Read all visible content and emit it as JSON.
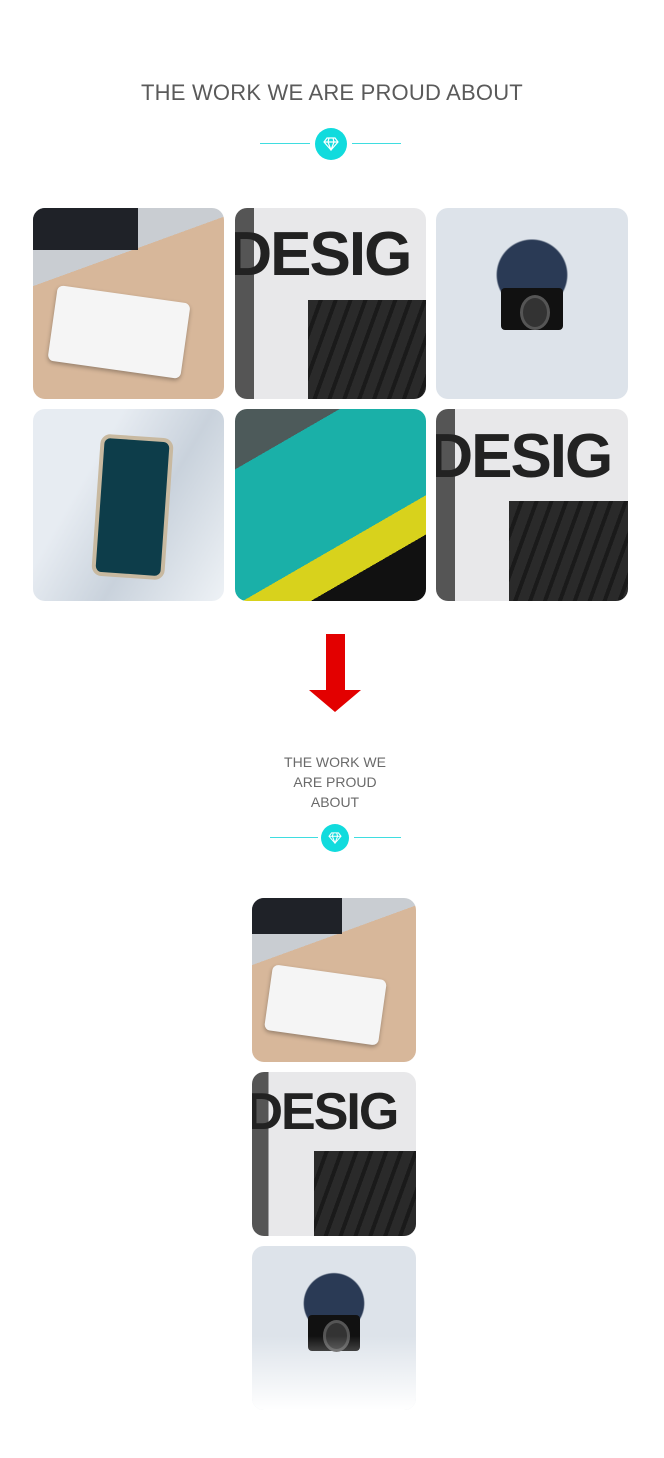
{
  "desktop": {
    "title": "THE WORK WE ARE PROUD ABOUT",
    "divider_icon": "diamond-icon",
    "accent_color": "#11dbdd",
    "gallery": [
      {
        "image": "imac-ipad-desk"
      },
      {
        "image": "design-pencils",
        "lettering": "DESIG"
      },
      {
        "image": "man-holding-camera"
      },
      {
        "image": "hand-holding-smartphone"
      },
      {
        "image": "tablet-app-screen"
      },
      {
        "image": "design-pencils",
        "lettering": "DESIG"
      }
    ]
  },
  "arrow": {
    "icon": "arrow-down-icon",
    "color": "#e30000"
  },
  "mobile": {
    "title_lines": [
      "THE WORK WE",
      "ARE PROUD",
      "ABOUT"
    ],
    "divider_icon": "diamond-icon",
    "gallery": [
      {
        "image": "imac-ipad-desk"
      },
      {
        "image": "design-pencils",
        "lettering": "DESIG"
      },
      {
        "image": "man-holding-camera"
      }
    ]
  }
}
